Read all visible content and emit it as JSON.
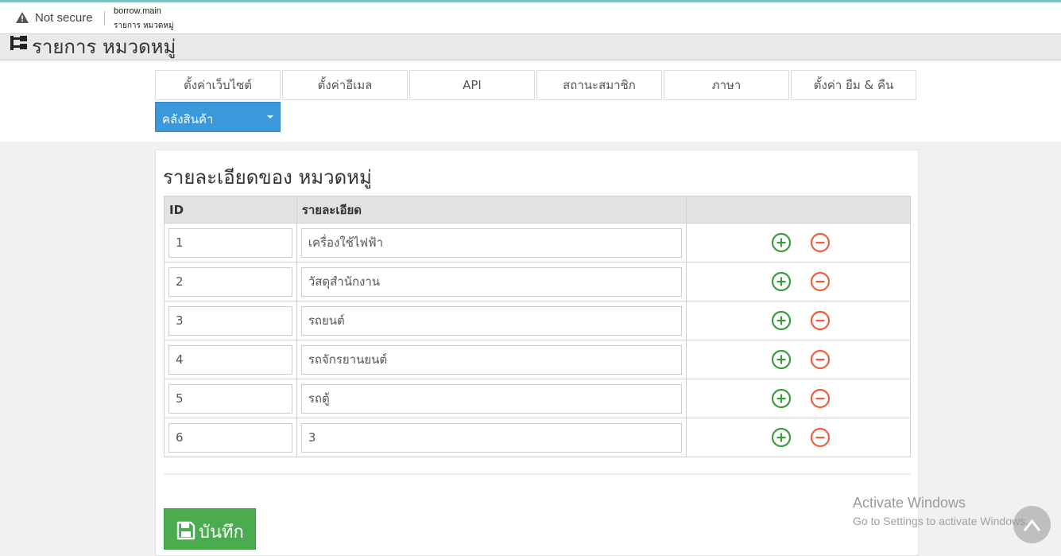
{
  "browser": {
    "security_label": "Not secure",
    "host": "borrow.main",
    "page_title": "รายการ หมวดหมู่"
  },
  "header": {
    "title": "รายการ หมวดหมู่"
  },
  "nav": {
    "tabs": [
      {
        "label": "ตั้งค่าเว็บไซต์"
      },
      {
        "label": "ตั้งค่าอีเมล"
      },
      {
        "label": "API"
      },
      {
        "label": "สถานะสมาชิก"
      },
      {
        "label": "ภาษา"
      },
      {
        "label": "ตั้งค่า ยืม & คืน"
      }
    ],
    "dropdown": {
      "label": "คลังสินค้า"
    }
  },
  "panel": {
    "title": "รายละเอียดของ หมวดหมู่",
    "columns": [
      "ID",
      "รายละเอียด",
      ""
    ],
    "rows": [
      {
        "id": "1",
        "detail": "เครื่องใช้ไฟฟ้า"
      },
      {
        "id": "2",
        "detail": "วัสดุสำนักงาน"
      },
      {
        "id": "3",
        "detail": "รถยนต์"
      },
      {
        "id": "4",
        "detail": "รถจักรยานยนต์"
      },
      {
        "id": "5",
        "detail": "รถตู้"
      },
      {
        "id": "6",
        "detail": "3"
      }
    ],
    "save_label": "บันทึก"
  },
  "watermark": {
    "line1": "Activate Windows",
    "line2": "Go to Settings to activate Windows."
  },
  "colors": {
    "accent_blue": "#3a98db",
    "save_green": "#4aab4f",
    "add_green": "#3a9a3e",
    "remove_red": "#e8603c"
  },
  "icons": {
    "warning": "warning-triangle-icon",
    "tree": "sitemap-icon",
    "add": "plus-circle-icon",
    "remove": "minus-circle-icon",
    "save": "floppy-disk-icon",
    "scroll_top": "chevron-up-icon"
  }
}
